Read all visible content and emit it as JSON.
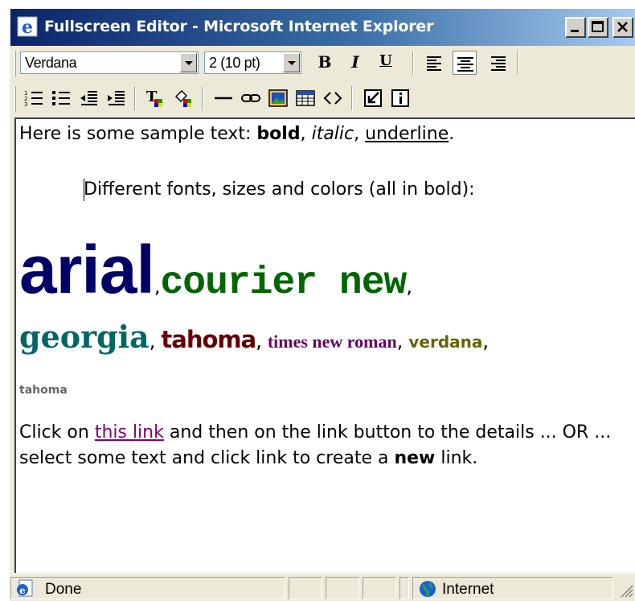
{
  "window": {
    "title": "Fullscreen Editor - Microsoft Internet Explorer"
  },
  "toolbar": {
    "font_name": "Verdana",
    "font_size": "2 (10 pt)",
    "bold_label": "B",
    "italic_label": "I",
    "underline_label": "U"
  },
  "content": {
    "line1_prefix": "Here is some sample text: ",
    "line1_bold": "bold",
    "line1_sep1": ", ",
    "line1_italic": "italic",
    "line1_sep2": ", ",
    "line1_underline": "underline",
    "line1_end": ".",
    "line2": "Different fonts, sizes and colors (all in bold):",
    "font_arial": "arial",
    "font_courier": "courier new",
    "font_georgia": "georgia",
    "font_tahoma": "tahoma",
    "font_times": "times new roman",
    "font_verdana": "verdana",
    "font_tahoma_small": "tahoma",
    "comma": ",",
    "para_prefix": "Click on ",
    "para_link": "this link",
    "para_mid": " and then on the link button to the details ... OR ... select some text and click link to create a ",
    "para_bold": "new",
    "para_end": " link."
  },
  "statusbar": {
    "status": "Done",
    "zone": "Internet"
  },
  "colors": {
    "arial": "#000066",
    "courier": "#006600",
    "georgia": "#006666",
    "tahoma": "#660000",
    "times": "#660066",
    "verdana": "#666600",
    "link": "#800080"
  }
}
